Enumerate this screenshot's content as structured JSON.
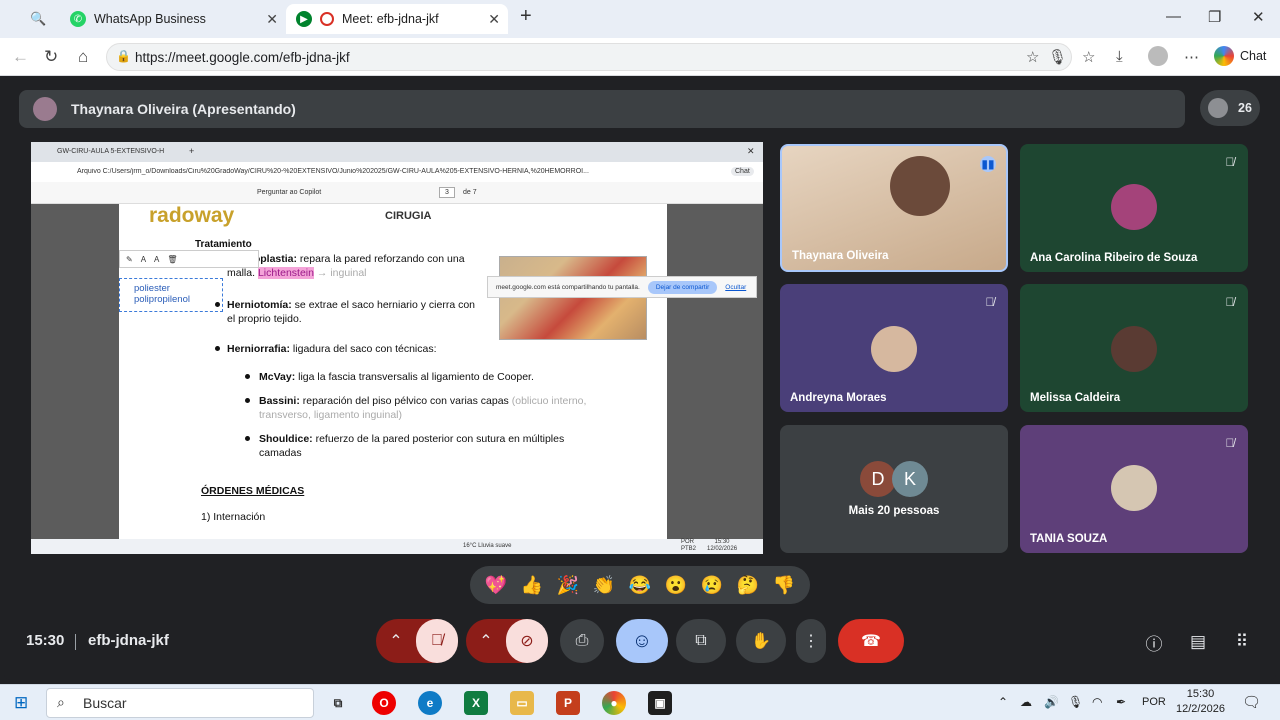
{
  "browser": {
    "tabs": [
      {
        "label": "WhatsApp Business",
        "active": false
      },
      {
        "label": "Meet: efb-jdna-jkf",
        "active": true
      }
    ],
    "url": "https://meet.google.com/efb-jdna-jkf",
    "chat_label": "Chat"
  },
  "meet": {
    "presenter_label": "Thaynara Oliveira (Apresentando)",
    "participant_count": "26",
    "time": "15:30",
    "meeting_code": "efb-jdna-jkf",
    "participants": [
      {
        "name": "Thaynara Oliveira",
        "muted": false,
        "speaking": true
      },
      {
        "name": "Ana Carolina Ribeiro de Souza",
        "muted": true
      },
      {
        "name": "Andreyna Moraes",
        "muted": true
      },
      {
        "name": "Melissa Caldeira",
        "muted": true
      },
      {
        "name": "Mais 20 pessoas",
        "initials": [
          "D",
          "K"
        ]
      },
      {
        "name": "TANIA SOUZA",
        "muted": true
      }
    ],
    "reactions": [
      "💖",
      "👍",
      "🎉",
      "👏",
      "😂",
      "😮",
      "😢",
      "🤔",
      "👎"
    ]
  },
  "shared_screen": {
    "edge_tab": "GW-CIRU-AULA 5-EXTENSIVO-H",
    "edge_url": "Arquivo   C:/Users/jrm_o/Downloads/Ciru%20GradoWay/CIRU%20-%20EXTENSIVO/Junio%202025/GW-CIRU-AULA%205-EXTENSIVO-HERNIA,%20HEMORROI...",
    "edge_copilot": "Perguntar ao Copilot",
    "edge_page": "3",
    "edge_pages": "de 7",
    "share_notice": "meet.google.com está compartilhando tu pantalla.",
    "stop_share": "Dejar de compartir",
    "hide": "Ocultar",
    "doc": {
      "brand": "radoway",
      "header": "CIRUGIA",
      "section": "Tratamiento",
      "annotation_line1": "poliester",
      "annotation_line2": "polipropilenol",
      "p1_bold": "Hernioplastia:",
      "p1_text": " repara la pared reforzando con una",
      "p1_line2": "malla. ",
      "p1_highlight": "Lichtenstein",
      "p1_grey": " → inguinal",
      "p2_bold": "Herniotomía:",
      "p2_text": " se extrae el saco herniario y cierra con",
      "p2_line2": "el proprio tejido.",
      "p3_bold": "Herniorrafia:",
      "p3_text": " ligadura del saco con técnicas:",
      "s1_bold": "McVay:",
      "s1_text": " liga la fascia transversalis al ligamiento de Cooper.",
      "s2_bold": "Bassini:",
      "s2_text": " reparación del piso pélvico con varias capas",
      "s2_grey": " (oblicuo interno,",
      "s2_grey2": "transverso, ligamento inguinal)",
      "s3_bold": "Shouldice:",
      "s3_text": " refuerzo de la pared posterior con sutura en múltiples",
      "s3_line2": "camadas",
      "orders_title": "ÓRDENES MÉDICAS",
      "orders_item": "1) Internación"
    },
    "inner_taskbar": {
      "weather": "16°C  Lluvia suave",
      "lang": "POR",
      "lang2": "PTB2",
      "time": "15:30",
      "date": "12/02/2026"
    }
  },
  "taskbar": {
    "search_placeholder": "Buscar",
    "lang": "POR",
    "time": "15:30",
    "date": "12/2/2026"
  },
  "colors": {
    "meet_bg": "#202124",
    "end_call": "#d93025",
    "muted_ctl": "#f9dedc",
    "emoji_ctl": "#a8c7fa"
  }
}
